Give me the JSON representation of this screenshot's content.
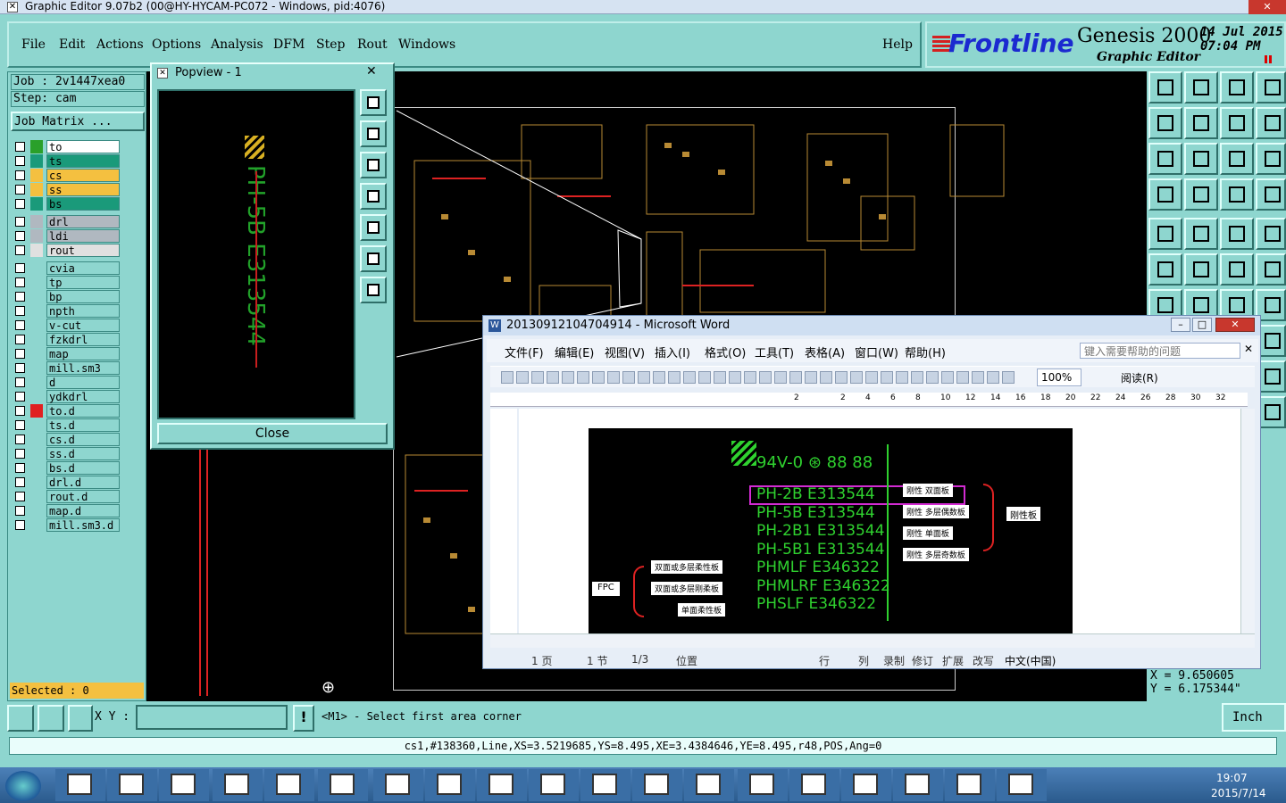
{
  "window": {
    "title": "Graphic Editor 9.07b2 (00@HY-HYCAM-PC072 - Windows, pid:4076)"
  },
  "menu": {
    "file": "File",
    "edit": "Edit",
    "actions": "Actions",
    "options": "Options",
    "analysis": "Analysis",
    "dfm": "DFM",
    "step": "Step",
    "rout": "Rout",
    "windows": "Windows",
    "help": "Help"
  },
  "brand": {
    "logo": "Frontline",
    "product": "Genesis 2000",
    "subtitle": "Graphic Editor",
    "date": "14 Jul 2015",
    "time": "07:04 PM"
  },
  "job": {
    "job_label": "Job : 2v1447xea0",
    "step_label": "Step: cam",
    "matrix_button": "Job Matrix ..."
  },
  "layers": [
    {
      "name": "to",
      "color": "#2aa02a",
      "bg": "#ffffff"
    },
    {
      "name": "ts",
      "color": "#1a9a7a",
      "bg": "#1a9a7a"
    },
    {
      "name": "cs",
      "color": "#f4c040",
      "bg": "#f4c040"
    },
    {
      "name": "ss",
      "color": "#f4c040",
      "bg": "#f4c040"
    },
    {
      "name": "bs",
      "color": "#1a9a7a",
      "bg": "#1a9a7a"
    },
    {
      "name": "drl",
      "color": "#b0b8c0",
      "bg": "#b0b8c0"
    },
    {
      "name": "ldi",
      "color": "#b0b8c0",
      "bg": "#b0b8c0"
    },
    {
      "name": "rout",
      "color": "#e0e0e0",
      "bg": "#e0e0e0"
    },
    {
      "name": "cvia",
      "color": "#8ed6cf",
      "bg": "#8ed6cf"
    },
    {
      "name": "tp",
      "color": "#8ed6cf",
      "bg": "#8ed6cf"
    },
    {
      "name": "bp",
      "color": "#8ed6cf",
      "bg": "#8ed6cf"
    },
    {
      "name": "npth",
      "color": "#8ed6cf",
      "bg": "#8ed6cf"
    },
    {
      "name": "v-cut",
      "color": "#8ed6cf",
      "bg": "#8ed6cf"
    },
    {
      "name": "fzkdrl",
      "color": "#8ed6cf",
      "bg": "#8ed6cf"
    },
    {
      "name": "map",
      "color": "#8ed6cf",
      "bg": "#8ed6cf"
    },
    {
      "name": "mill.sm3",
      "color": "#8ed6cf",
      "bg": "#8ed6cf"
    },
    {
      "name": "d",
      "color": "#8ed6cf",
      "bg": "#8ed6cf"
    },
    {
      "name": "ydkdrl",
      "color": "#8ed6cf",
      "bg": "#8ed6cf"
    },
    {
      "name": "to.d",
      "color": "#e02020",
      "bg": "#8ed6cf"
    },
    {
      "name": "ts.d",
      "color": "#8ed6cf",
      "bg": "#8ed6cf"
    },
    {
      "name": "cs.d",
      "color": "#8ed6cf",
      "bg": "#8ed6cf"
    },
    {
      "name": "ss.d",
      "color": "#8ed6cf",
      "bg": "#8ed6cf"
    },
    {
      "name": "bs.d",
      "color": "#8ed6cf",
      "bg": "#8ed6cf"
    },
    {
      "name": "drl.d",
      "color": "#8ed6cf",
      "bg": "#8ed6cf"
    },
    {
      "name": "rout.d",
      "color": "#8ed6cf",
      "bg": "#8ed6cf"
    },
    {
      "name": "map.d",
      "color": "#8ed6cf",
      "bg": "#8ed6cf"
    },
    {
      "name": "mill.sm3.d",
      "color": "#8ed6cf",
      "bg": "#8ed6cf"
    }
  ],
  "selected": "Selected : 0",
  "popview": {
    "title": "Popview - 1",
    "close_label": "Close",
    "text": "PH-5B E313544"
  },
  "command": {
    "xy_label": "X Y :",
    "prompt": "<M1> - Select first area corner",
    "units": "Inch"
  },
  "coords": {
    "x": "X = 9.650605",
    "y": "Y = 6.175344\""
  },
  "feature_info": "cs1,#138360,Line,XS=3.5219685,YS=8.495,XE=3.4384646,YE=8.495,r48,POS,Ang=0",
  "word": {
    "title": "20130912104704914 - Microsoft Word",
    "menu": [
      "文件(F)",
      "编辑(E)",
      "视图(V)",
      "插入(I)",
      "格式(O)",
      "工具(T)",
      "表格(A)",
      "窗口(W)",
      "帮助(H)"
    ],
    "help_placeholder": "键入需要帮助的问题",
    "zoom": "100%",
    "read_label": "阅读(R)",
    "ruler": [
      "2",
      "2",
      "4",
      "6",
      "8",
      "10",
      "12",
      "14",
      "16",
      "18",
      "20",
      "22",
      "24",
      "26",
      "28",
      "30",
      "32"
    ],
    "status": {
      "page": "1 页",
      "section": "1 节",
      "pages": "1/3",
      "position": "位置",
      "line": "行",
      "col": "列",
      "rec": "录制",
      "trk": "修订",
      "ext": "扩展",
      "ovr": "改写",
      "lang": "中文(中国)"
    },
    "figure": {
      "ul_text": "94V-0 ⊛ 88 88",
      "lines": [
        "PH-2B E313544",
        "PH-5B E313544",
        "PH-2B1 E313544",
        "PH-5B1 E313544",
        "PHMLF E346322",
        "PHMLRF E346322",
        "PHSLF E346322"
      ],
      "right_labels": [
        "刚性 双面板",
        "刚性 多层偶数板",
        "刚性 单面板",
        "刚性 多层奇数板"
      ],
      "group_right": "刚性板",
      "left_labels": [
        "双面或多层柔性板",
        "双面或多层刚柔板",
        "单面柔性板"
      ],
      "group_left": "FPC"
    }
  },
  "taskbar": {
    "time": "19:07",
    "date": "2015/7/14"
  }
}
